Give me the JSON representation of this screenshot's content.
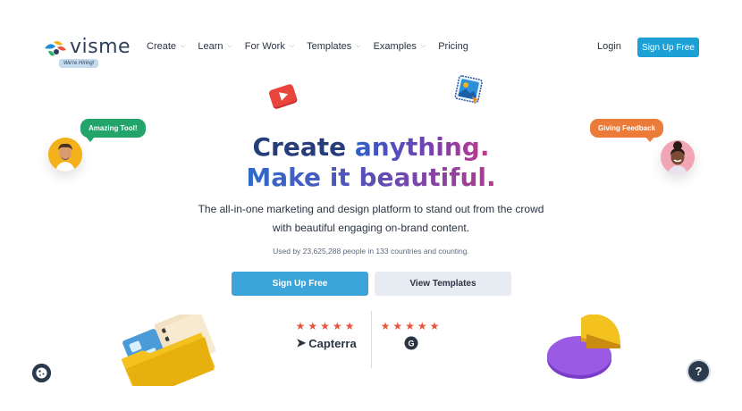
{
  "header": {
    "logo_text": "visme",
    "logo_badge": "We're Hiring!",
    "nav": [
      {
        "label": "Create",
        "has_dropdown": true
      },
      {
        "label": "Learn",
        "has_dropdown": true
      },
      {
        "label": "For Work",
        "has_dropdown": true
      },
      {
        "label": "Templates",
        "has_dropdown": true
      },
      {
        "label": "Examples",
        "has_dropdown": true
      },
      {
        "label": "Pricing",
        "has_dropdown": false
      }
    ],
    "login_label": "Login",
    "signup_label": "Sign Up Free"
  },
  "hero": {
    "title_line1_a": "Create",
    "title_line1_b": "anything.",
    "title_line2": "Make it beautiful.",
    "subtitle_line1": "The all-in-one marketing and design platform to stand out from the crowd",
    "subtitle_line2": "with beautiful engaging on-brand content.",
    "used_by": "Used by 23,625,288 people in 133 countries and counting.",
    "primary_button": "Sign Up Free",
    "secondary_button": "View Templates"
  },
  "testimonials": {
    "left_bubble": "Amazing Tool!",
    "right_bubble": "Giving Feedback"
  },
  "ratings": [
    {
      "stars": "★★★★★",
      "value": 4.5,
      "brand": "Capterra"
    },
    {
      "stars": "★★★★★",
      "value": 4.5,
      "brand": "G2"
    }
  ],
  "widgets": {
    "help_label": "?"
  },
  "colors": {
    "primary": "#1da0d6",
    "navy": "#253d7a",
    "star": "#e8553b",
    "bubble_green": "#23a46b",
    "bubble_orange": "#ec7b3a"
  }
}
